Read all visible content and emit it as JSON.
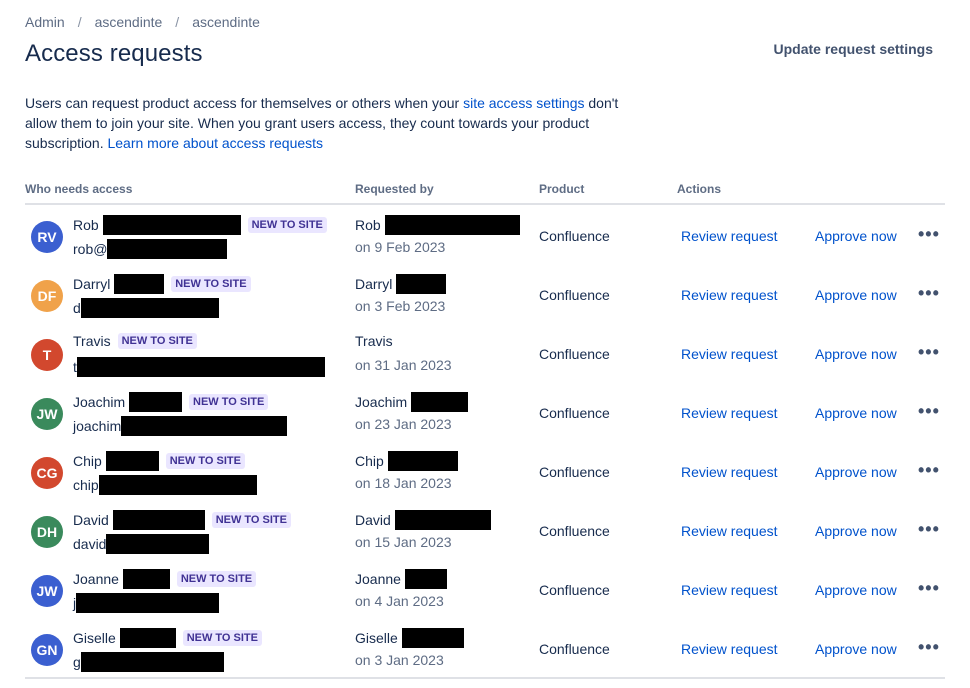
{
  "breadcrumb": [
    "Admin",
    "ascendinte",
    "ascendinte"
  ],
  "page_title": "Access requests",
  "update_button": "Update request settings",
  "description": {
    "part1": "Users can request product access for themselves or others when your ",
    "link1": "site access settings",
    "part2": " don't allow them to join your site. When you grant users access, they count towards your product subscription. ",
    "link2": "Learn more about access requests"
  },
  "columns": {
    "who": "Who needs access",
    "requested_by": "Requested by",
    "product": "Product",
    "actions": "Actions"
  },
  "lozenge_label": "NEW TO SITE",
  "action_labels": {
    "review": "Review request",
    "approve": "Approve now",
    "more": "•••"
  },
  "colors": {
    "accent_link": "#0052cc",
    "lozenge_bg": "#eae6ff",
    "lozenge_text": "#403294"
  },
  "rows": [
    {
      "initials": "RV",
      "avatar_color": "#3b5fd0",
      "first": "Rob",
      "email_prefix": "rob@",
      "req_first": "Rob",
      "date": "on 9 Feb 2023",
      "product": "Confluence"
    },
    {
      "initials": "DF",
      "avatar_color": "#f0a24a",
      "first": "Darryl",
      "email_prefix": "d",
      "req_first": "Darryl",
      "date": "on 3 Feb 2023",
      "product": "Confluence"
    },
    {
      "initials": "T",
      "avatar_color": "#d2482e",
      "first": "Travis",
      "email_prefix": "t",
      "req_first": "Travis",
      "date": "on 31 Jan 2023",
      "product": "Confluence"
    },
    {
      "initials": "JW",
      "avatar_color": "#3a8a5c",
      "first": "Joachim",
      "email_prefix": "joachim",
      "req_first": "Joachim",
      "date": "on 23 Jan 2023",
      "product": "Confluence"
    },
    {
      "initials": "CG",
      "avatar_color": "#d2482e",
      "first": "Chip",
      "email_prefix": "chip",
      "req_first": "Chip",
      "date": "on 18 Jan 2023",
      "product": "Confluence"
    },
    {
      "initials": "DH",
      "avatar_color": "#3a8a5c",
      "first": "David",
      "email_prefix": "david",
      "req_first": "David",
      "date": "on 15 Jan 2023",
      "product": "Confluence"
    },
    {
      "initials": "JW",
      "avatar_color": "#3b5fd0",
      "first": "Joanne",
      "email_prefix": "j",
      "req_first": "Joanne",
      "date": "on 4 Jan 2023",
      "product": "Confluence"
    },
    {
      "initials": "GN",
      "avatar_color": "#3b5fd0",
      "first": "Giselle",
      "email_prefix": "g",
      "req_first": "Giselle",
      "date": "on 3 Jan 2023",
      "product": "Confluence"
    }
  ]
}
